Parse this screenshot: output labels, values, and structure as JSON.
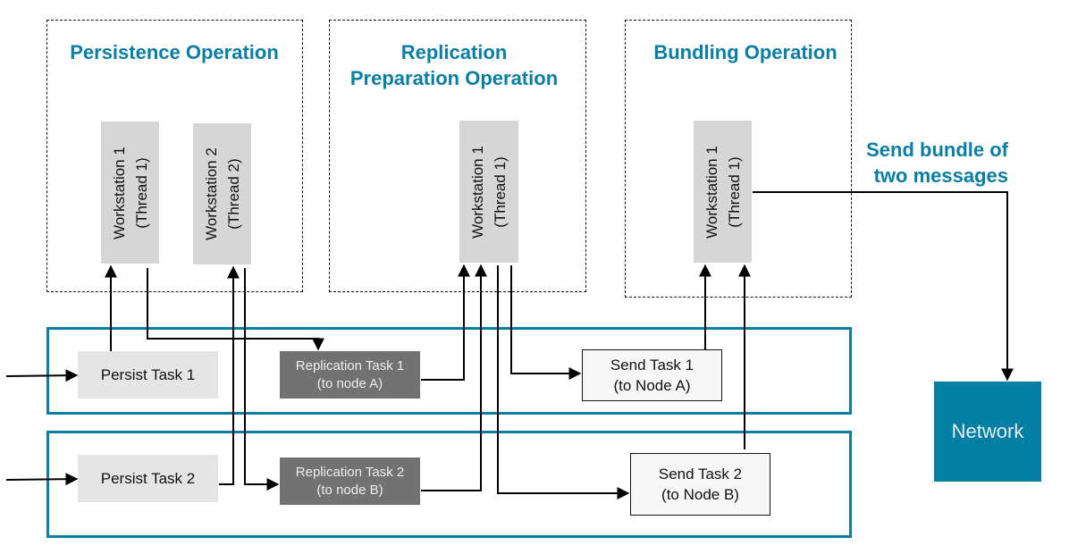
{
  "operations": {
    "persistence": {
      "title": "Persistence Operation"
    },
    "replication": {
      "title_line1": "Replication",
      "title_line2": "Preparation Operation"
    },
    "bundling": {
      "title": "Bundling Operation"
    }
  },
  "workstations": {
    "persist_ws1": {
      "line1": "Workstation 1",
      "line2": "(Thread 1)"
    },
    "persist_ws2": {
      "line1": "Workstation 2",
      "line2": "(Thread 2)"
    },
    "repl_ws1": {
      "line1": "Workstation 1",
      "line2": "(Thread 1)"
    },
    "bundle_ws1": {
      "line1": "Workstation 1",
      "line2": "(Thread 1)"
    }
  },
  "tasks": {
    "persist1": {
      "label": "Persist Task 1"
    },
    "persist2": {
      "label": "Persist Task 2"
    },
    "repl1": {
      "line1": "Replication Task 1",
      "line2": "(to node A)"
    },
    "repl2": {
      "line1": "Replication Task 2",
      "line2": "(to node B)"
    },
    "send1": {
      "line1": "Send Task 1",
      "line2": "(to Node A)"
    },
    "send2": {
      "line1": "Send Task 2",
      "line2": "(to Node B)"
    }
  },
  "network": {
    "label": "Network"
  },
  "annotation": {
    "line1": "Send bundle of",
    "line2": "two messages"
  },
  "colors": {
    "accent": "#0a7ea4",
    "network": "#047fa4",
    "replication_task": "#727272",
    "workstation": "#d6d6d6",
    "persist_task": "#e5e5e5"
  }
}
